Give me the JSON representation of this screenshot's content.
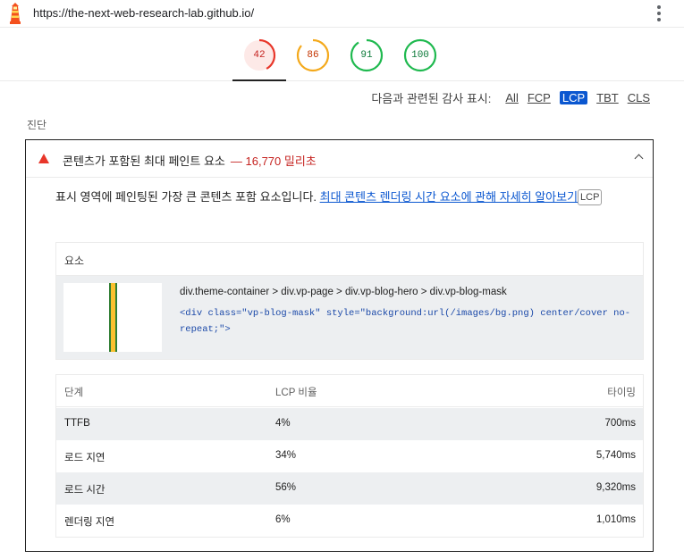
{
  "browser": {
    "url": "https://the-next-web-research-lab.github.io/",
    "logo_icon": "lighthouse-icon",
    "menu_icon": "kebab-menu-icon"
  },
  "scores": [
    {
      "value": "42",
      "fraction": 0.42,
      "color": "#e8362a",
      "bg": "#fde9e7",
      "text_color": "#c5221f"
    },
    {
      "value": "86",
      "fraction": 0.86,
      "color": "#f4a91b",
      "bg": "#ffffff",
      "text_color": "#c33300"
    },
    {
      "value": "91",
      "fraction": 0.91,
      "color": "#1fb94f",
      "bg": "#ffffff",
      "text_color": "#0d7a3a"
    },
    {
      "value": "100",
      "fraction": 1.0,
      "color": "#1fb94f",
      "bg": "#ffffff",
      "text_color": "#0d7a3a"
    }
  ],
  "filter": {
    "label": "다음과 관련된 감사 표시:",
    "options": [
      "All",
      "FCP",
      "LCP",
      "TBT",
      "CLS"
    ],
    "active": "LCP"
  },
  "section_title": "진단",
  "audit": {
    "status_icon": "fail-triangle-icon",
    "title": "콘텐츠가 포함된 최대 페인트 요소",
    "value": "— 16,770 밀리초",
    "description": "표시 영역에 페인팅된 가장 큰 콘텐츠 포함 요소입니다. ",
    "link_text": "최대 콘텐츠 렌더링 시간 요소에 관해 자세히 알아보기",
    "tag": "LCP",
    "element_table": {
      "header": "요소",
      "selector": "div.theme-container > div.vp-page > div.vp-blog-hero > div.vp-blog-mask",
      "snippet": "<div class=\"vp-blog-mask\" style=\"background:url(/images/bg.png) center/cover no-repeat;\">"
    },
    "phase_table": {
      "headers": [
        "단계",
        "LCP 비율",
        "타이밍"
      ],
      "rows": [
        {
          "phase": "TTFB",
          "percent": "4%",
          "timing": "700ms"
        },
        {
          "phase": "로드 지연",
          "percent": "34%",
          "timing": "5,740ms"
        },
        {
          "phase": "로드 시간",
          "percent": "56%",
          "timing": "9,320ms"
        },
        {
          "phase": "렌더링 지연",
          "percent": "6%",
          "timing": "1,010ms"
        }
      ]
    }
  }
}
